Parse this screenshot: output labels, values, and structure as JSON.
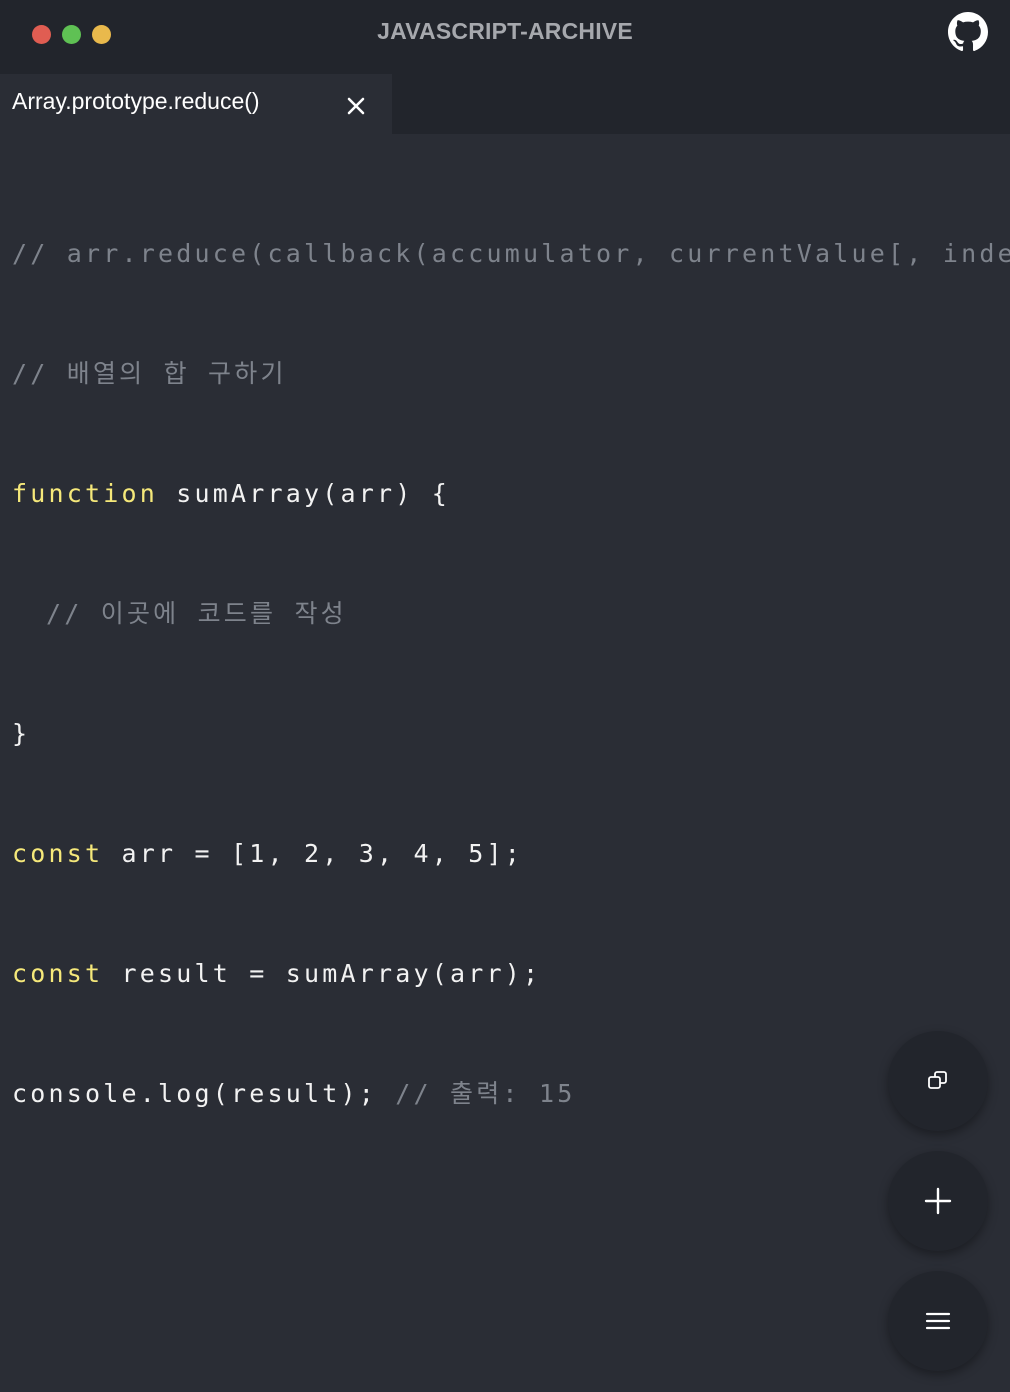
{
  "titlebar": {
    "title": "JAVASCRIPT-ARCHIVE",
    "traffic_lights": {
      "close": "#e05d52",
      "minimize": "#5fc154",
      "maximize": "#e9b94c"
    },
    "github_icon": "github-icon"
  },
  "tabs": [
    {
      "label": "Array.prototype.reduce()",
      "active": true,
      "close_icon": "close-icon"
    }
  ],
  "editor": {
    "lines": [
      {
        "comment": "// arr.reduce(callback(accumulator, currentValue[, index[, array]])[, initialValue])"
      },
      {
        "comment": "// 배열의 합 구하기"
      },
      {
        "keyword": "function",
        "text": " sumArray(arr) {"
      },
      {
        "comment": "// 이곳에 코드를 작성"
      },
      {
        "text": "}"
      },
      {
        "keyword": "const",
        "text": " arr = [1, 2, 3, 4, 5];"
      },
      {
        "keyword": "const",
        "text": " result = sumArray(arr);"
      },
      {
        "text": "console.log(result); ",
        "comment": "// 출력: 15"
      }
    ],
    "colors": {
      "comment": "#7e838c",
      "keyword": "#f5e87a",
      "text": "#f2f2f2",
      "background": "#2a2d35"
    }
  },
  "fabs": {
    "copy_icon": "copy-icon",
    "add_icon": "plus-icon",
    "menu_icon": "hamburger-menu-icon"
  }
}
